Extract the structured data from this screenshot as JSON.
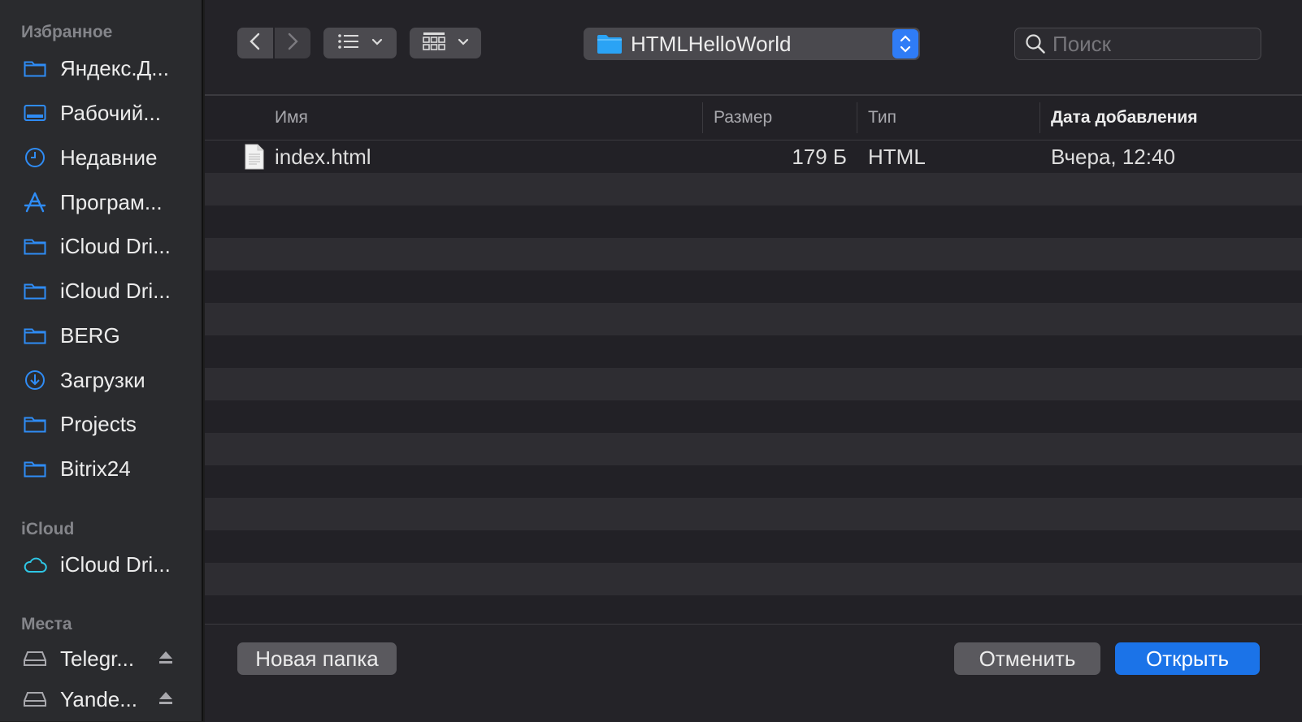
{
  "sidebar": {
    "favorites_title": "Избранное",
    "favorites": [
      {
        "label": "Яндекс.Д...",
        "icon": "folder-icon"
      },
      {
        "label": "Рабочий...",
        "icon": "desktop-icon"
      },
      {
        "label": "Недавние",
        "icon": "clock-icon"
      },
      {
        "label": "Програм...",
        "icon": "applications-icon"
      },
      {
        "label": "iCloud Dri...",
        "icon": "folder-icon"
      },
      {
        "label": "iCloud Dri...",
        "icon": "folder-icon"
      },
      {
        "label": "BERG",
        "icon": "folder-icon"
      },
      {
        "label": "Загрузки",
        "icon": "download-icon"
      },
      {
        "label": "Projects",
        "icon": "folder-icon"
      },
      {
        "label": "Bitrix24",
        "icon": "folder-icon"
      }
    ],
    "icloud_title": "iCloud",
    "icloud": [
      {
        "label": "iCloud Dri...",
        "icon": "cloud-icon"
      }
    ],
    "places_title": "Места",
    "places": [
      {
        "label": "Telegr...",
        "icon": "drive-icon"
      },
      {
        "label": "Yande...",
        "icon": "drive-icon"
      }
    ]
  },
  "toolbar": {
    "path": "HTMLHelloWorld",
    "search_placeholder": "Поиск"
  },
  "table": {
    "columns": {
      "name": "Имя",
      "size": "Размер",
      "type": "Тип",
      "date": "Дата добавления"
    },
    "rows": [
      {
        "name": "index.html",
        "size": "179 Б",
        "type": "HTML",
        "date": "Вчера, 12:40"
      }
    ]
  },
  "footer": {
    "new_folder": "Новая папка",
    "cancel": "Отменить",
    "open": "Открыть"
  },
  "colors": {
    "accent": "#1b73e8",
    "folder": "#2aa3f5",
    "sidebar_icon": "#2f8cf5"
  }
}
